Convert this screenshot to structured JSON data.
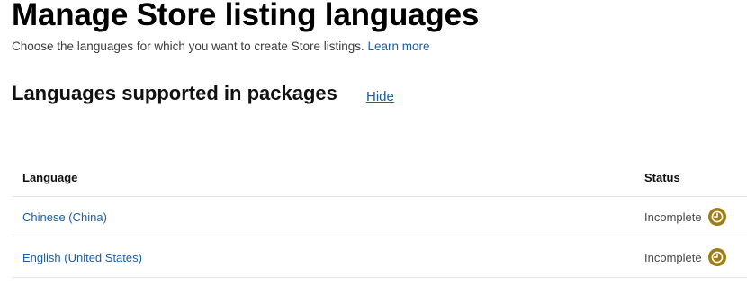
{
  "header": {
    "title": "Manage Store listing languages",
    "subtitle": "Choose the languages for which you want to create Store listings.",
    "learn_more": "Learn more"
  },
  "section": {
    "title": "Languages supported in packages",
    "hide_label": "Hide"
  },
  "table": {
    "columns": [
      "Language",
      "Status"
    ],
    "rows": [
      {
        "language": "Chinese (China)",
        "status": "Incomplete",
        "status_icon": "incomplete-clock-icon"
      },
      {
        "language": "English (United States)",
        "status": "Incomplete",
        "status_icon": "incomplete-clock-icon"
      }
    ]
  },
  "colors": {
    "link": "#1a5fa8",
    "status_incomplete": "#a07d12"
  }
}
